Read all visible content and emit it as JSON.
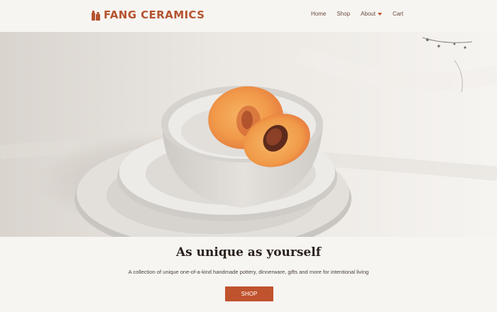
{
  "brand": {
    "name": "FANG CERAMICS",
    "color": "#b5532f"
  },
  "nav": {
    "items": [
      {
        "label": "Home"
      },
      {
        "label": "Shop"
      },
      {
        "label": "About"
      },
      {
        "label": "Cart"
      }
    ]
  },
  "hero": {
    "image_icon": "ceramic-bowl-with-peach-photo"
  },
  "main": {
    "tagline": "As unique as yourself",
    "subtitle": "A collection of unique one-of-a-kind handmade pottery, dinnerware, gifts and more for intentional living",
    "shop_button": "SHOP"
  },
  "colors": {
    "accent": "#c0532e",
    "background": "#f7f5f2"
  }
}
